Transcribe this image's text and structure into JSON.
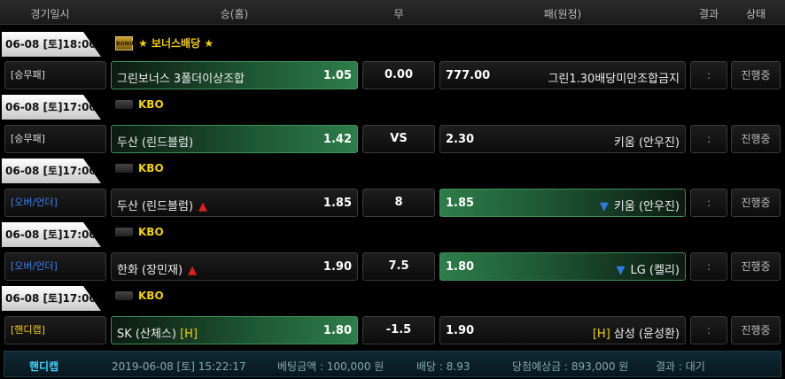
{
  "header": {
    "col_date": "경기일시",
    "col_home": "승(홈)",
    "col_draw": "무",
    "col_away": "패(원정)",
    "col_result": "결과",
    "col_status": "상태"
  },
  "groups": [
    {
      "date": "06-08 [토]18:00",
      "league_icon": "bonus-icon",
      "league_name": "★ 보너스배당 ★",
      "bet_type": "[승무패]",
      "home_team": "그린보너스 3폴더이상조합",
      "home_odds": "1.05",
      "middle": "0.00",
      "away_odds": "777.00",
      "away_team": "그린1.30배당미만조합금지",
      "result": ":",
      "status": "진행중"
    },
    {
      "date": "06-08 [토]17:00",
      "league_icon": "kbo-icon",
      "league_name": "KBO",
      "bet_type": "[승무패]",
      "home_team": "두산 (린드블럼)",
      "home_odds": "1.42",
      "middle": "VS",
      "away_odds": "2.30",
      "away_team": "키움 (안우진)",
      "result": ":",
      "status": "진행중"
    },
    {
      "date": "06-08 [토]17:00",
      "league_icon": "kbo-icon",
      "league_name": "KBO",
      "bet_type": "[오버/언더]",
      "home_team": "두산 (린드블럼)",
      "home_odds": "1.85",
      "middle": "8",
      "away_odds": "1.85",
      "away_team": "키움 (안우진)",
      "result": ":",
      "status": "진행중"
    },
    {
      "date": "06-08 [토]17:00",
      "league_icon": "kbo-icon",
      "league_name": "KBO",
      "bet_type": "[오버/언더]",
      "home_team": "한화 (장민재)",
      "home_odds": "1.90",
      "middle": "7.5",
      "away_odds": "1.80",
      "away_team": "LG (켈리)",
      "result": ":",
      "status": "진행중"
    },
    {
      "date": "06-08 [토]17:00",
      "league_icon": "kbo-icon",
      "league_name": "KBO",
      "bet_type": "[핸디캡]",
      "home_team": "SK (산체스)",
      "home_flag": "[H]",
      "home_odds": "1.80",
      "middle": "-1.5",
      "away_odds": "1.90",
      "away_flag": "[H]",
      "away_team": "삼성 (윤성환)",
      "result": ":",
      "status": "진행중"
    }
  ],
  "icons": {
    "over_arrow": "▲",
    "under_arrow": "▼",
    "bonus_text": "BONUS"
  },
  "footer": {
    "bet_type": "핸디캡",
    "datetime": "2019-06-08 [토] 15:22:17",
    "amount": "베팅금액 : 100,000 원",
    "odds": "배당 : 8.93",
    "payout": "당첨예상금 : 893,000 원",
    "result": "결과 : 대기"
  },
  "colors": {
    "accent_green": "#2e7d4a",
    "league_yellow": "#f5d000",
    "type_blue": "#3b82f6",
    "arrow_red": "#e02020",
    "arrow_blue": "#2b7de0"
  }
}
